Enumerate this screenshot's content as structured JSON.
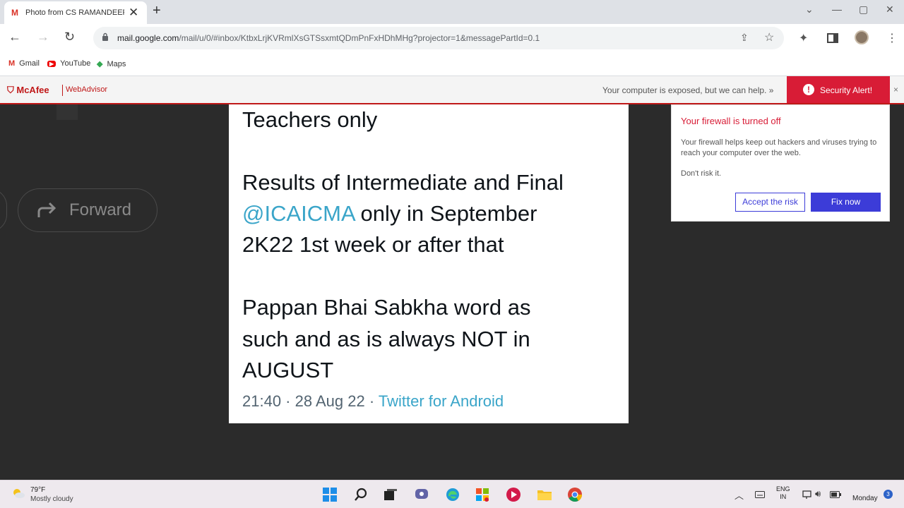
{
  "browser": {
    "tab_title": "Photo from CS RAMANDEEP S",
    "tab_favicon": "gmail-icon",
    "url_host": "mail.google.com",
    "url_path": "/mail/u/0/#inbox/KtbxLrjKVRmlXsGTSsxmtQDmPnFxHDhMHg?projector=1&messagePartId=0.1",
    "bookmarks": [
      {
        "label": "Gmail",
        "icon": "gmail-icon"
      },
      {
        "label": "YouTube",
        "icon": "youtube-icon"
      },
      {
        "label": "Maps",
        "icon": "maps-icon"
      }
    ]
  },
  "mcafee": {
    "brand": "McAfee",
    "product": "WebAdvisor",
    "message": "Your computer is exposed, but we can help. »",
    "alert_label": "Security Alert!",
    "close": "×",
    "accent_color": "#d81c36"
  },
  "popup": {
    "heading": "Your firewall is turned off",
    "body": "Your firewall helps keep out hackers and viruses trying to reach your computer over the web.",
    "dont_risk": "Don't risk it.",
    "accept_label": "Accept the risk",
    "fix_label": "Fix now",
    "button_color": "#3c3cd8"
  },
  "viewer": {
    "forward_label": "Forward"
  },
  "tweet": {
    "line1": "Teachers only",
    "line2": "Results of Intermediate and Final",
    "mention": "@ICAICMA",
    "line3_rest": " only in September",
    "line4": "2K22 1st week or after that",
    "line5": "Pappan Bhai Sabkha word as",
    "line6": "such and as is always NOT in",
    "line7": "AUGUST",
    "timestamp": "21:40 · 28 Aug 22 · ",
    "via": "Twitter for Android"
  },
  "taskbar": {
    "temperature": "79°F",
    "condition": "Mostly cloudy",
    "lang_line1": "ENG",
    "lang_line2": "IN",
    "day": "Monday",
    "notification_count": "3"
  }
}
